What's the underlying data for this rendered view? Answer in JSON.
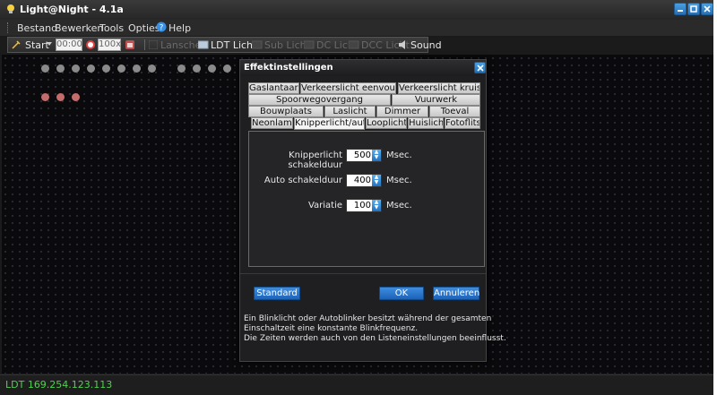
{
  "window": {
    "title": "Light@Night - 4.1a"
  },
  "menu": [
    "Bestand",
    "Bewerken",
    "Tools",
    "Opties",
    "Help"
  ],
  "toolbar": {
    "start_label": "Start",
    "time_value": "00:00",
    "speed_value": "100x",
    "items": [
      {
        "label": "Lanschen",
        "enabled": false
      },
      {
        "label": "LDT Licht",
        "enabled": true
      },
      {
        "label": "Sub Licht",
        "enabled": false
      },
      {
        "label": "DC Licht",
        "enabled": false
      },
      {
        "label": "DCC Licht",
        "enabled": false
      },
      {
        "label": "Sound",
        "enabled": true
      }
    ]
  },
  "canvas": {
    "led_colors": {
      "grey": "#8a8a8a",
      "red": "#c46b6b"
    }
  },
  "status": {
    "text": "LDT 169.254.123.113",
    "color": "#4fd14f"
  },
  "dialog": {
    "title": "Effektinstellingen",
    "tabs_row1": [
      "Gaslantaarn",
      "Verkeerslicht eenvoudig",
      "Verkeerslicht kruising"
    ],
    "tabs_row2": [
      "Spoorwegovergang",
      "Vuurwerk"
    ],
    "tabs_row3": [
      "Bouwplaats",
      "Laslicht",
      "Dimmer",
      "Toeval"
    ],
    "tabs_row4": [
      "Neonlamp",
      "Knipperlicht/auto",
      "Looplicht",
      "Huislicht",
      "Fotoflits"
    ],
    "active_tab": "Knipperlicht/auto",
    "fields": [
      {
        "label": "Knipperlicht schakelduur",
        "value": "500",
        "unit": "Msec."
      },
      {
        "label": "Auto schakelduur",
        "value": "400",
        "unit": "Msec."
      },
      {
        "label": "Variatie",
        "value": "100",
        "unit": "Msec."
      }
    ],
    "buttons": {
      "standard": "Standard",
      "ok": "OK",
      "cancel": "Annuleren"
    },
    "info": [
      "Ein Blinklicht oder Autoblinker besitzt während der gesamten",
      "Einschaltzeit eine konstante Blinkfrequenz.",
      "Die Zeiten werden auch von den Listeneinstellungen beeinflusst."
    ]
  }
}
